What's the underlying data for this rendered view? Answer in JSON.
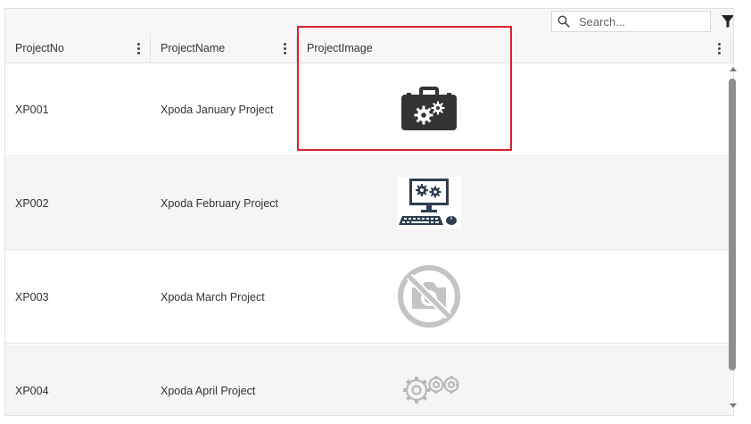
{
  "toolbar": {
    "search_placeholder": "Search...",
    "filter_icon": "filter-icon",
    "search_icon": "search-icon"
  },
  "columns": [
    "ProjectNo",
    "ProjectName",
    "ProjectImage"
  ],
  "rows": [
    {
      "no": "XP001",
      "name": "Xpoda January Project",
      "image": "toolbox-gears-icon"
    },
    {
      "no": "XP002",
      "name": "Xpoda February Project",
      "image": "computer-gears-icon"
    },
    {
      "no": "XP003",
      "name": "Xpoda March Project",
      "image": "no-camera-icon"
    },
    {
      "no": "XP004",
      "name": "Xpoda April Project",
      "image": "gears-icon"
    }
  ],
  "colors": {
    "highlight": "#d9232d",
    "alt_row": "#f5f5f5",
    "header_bg": "#f7f7f7"
  }
}
